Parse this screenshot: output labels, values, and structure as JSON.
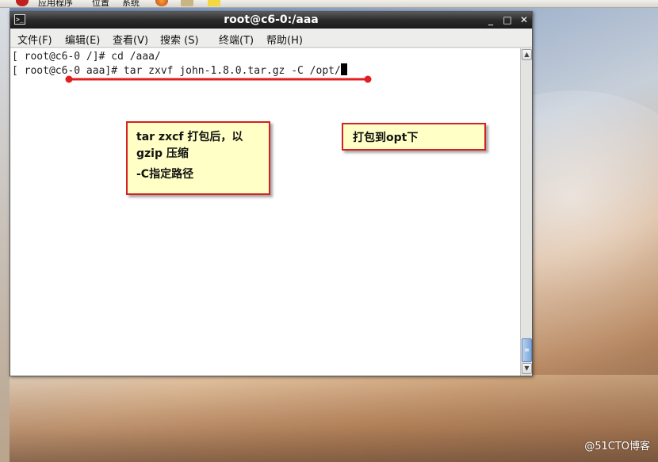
{
  "top_panel": {
    "applications": "应用程序",
    "places": "位置",
    "system": "系统"
  },
  "window": {
    "title": "root@c6-0:/aaa",
    "icons": [
      "terminal-icon",
      "minimize-icon",
      "maximize-icon",
      "close-icon"
    ],
    "buttons": {
      "minimize": "_",
      "maximize": "□",
      "close": "✕"
    }
  },
  "menu": {
    "file": "文件(F)",
    "edit": "编辑(E)",
    "view": "查看(V)",
    "search": "搜索 (S)",
    "terminal": "终端(T)",
    "help": "帮助(H)"
  },
  "terminal": {
    "line1": "[ root@c6-0 /]# cd /aaa/",
    "line2": "[ root@c6-0 aaa]# tar zxvf john-1.8.0.tar.gz -C /opt/"
  },
  "annotations": {
    "note1_line1": "tar zxcf 打包后，以",
    "note1_line2": "gzip 压缩",
    "note1_line3": "-C指定路径",
    "note2": "打包到opt下",
    "underline_color": "#e02020"
  },
  "watermark": "@51CTO博客"
}
